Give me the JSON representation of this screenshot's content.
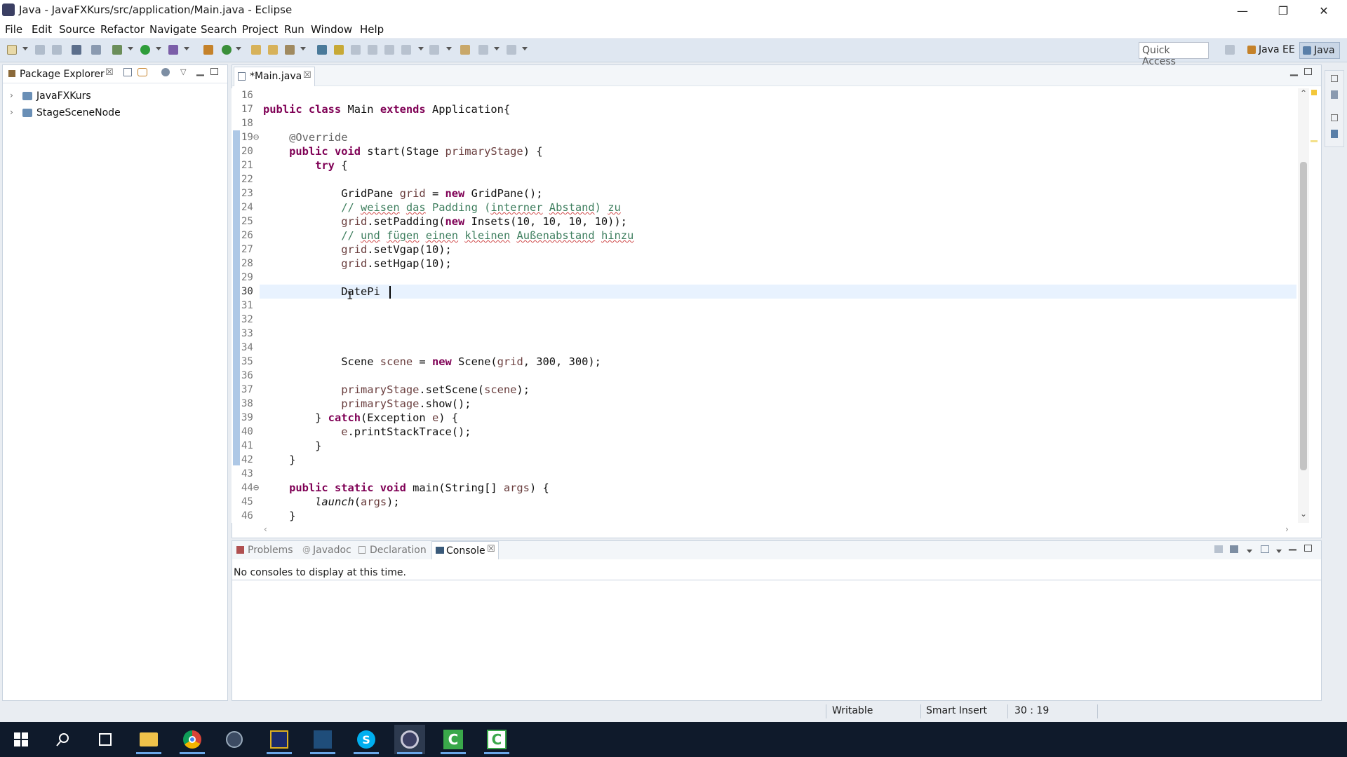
{
  "window": {
    "title": "Java - JavaFXKurs/src/application/Main.java - Eclipse",
    "min": "—",
    "max": "❐",
    "close": "✕"
  },
  "menu": [
    "File",
    "Edit",
    "Source",
    "Refactor",
    "Navigate",
    "Search",
    "Project",
    "Run",
    "Window",
    "Help"
  ],
  "toolbar": {
    "quick_access": "Quick Access",
    "perspectives": [
      "Java EE",
      "Java"
    ]
  },
  "package_explorer": {
    "tab": "Package Explorer",
    "items": [
      "JavaFXKurs",
      "StageSceneNode"
    ]
  },
  "editor": {
    "tab": "*Main.java",
    "lines": [
      {
        "n": "16",
        "tokens": []
      },
      {
        "n": "17",
        "tokens": [
          {
            "t": "public class ",
            "c": "kw"
          },
          {
            "t": "Main ",
            "c": ""
          },
          {
            "t": "extends ",
            "c": "kw"
          },
          {
            "t": "Application{",
            "c": ""
          }
        ]
      },
      {
        "n": "18",
        "tokens": []
      },
      {
        "n": "19⊖",
        "tokens": [
          {
            "t": "    @Override",
            "c": "an"
          }
        ]
      },
      {
        "n": "20",
        "tokens": [
          {
            "t": "    ",
            "c": ""
          },
          {
            "t": "public void ",
            "c": "kw"
          },
          {
            "t": "start(Stage ",
            "c": ""
          },
          {
            "t": "primaryStage",
            "c": "var"
          },
          {
            "t": ") {",
            "c": ""
          }
        ]
      },
      {
        "n": "21",
        "tokens": [
          {
            "t": "        ",
            "c": ""
          },
          {
            "t": "try ",
            "c": "kw"
          },
          {
            "t": "{",
            "c": ""
          }
        ]
      },
      {
        "n": "22",
        "tokens": []
      },
      {
        "n": "23",
        "tokens": [
          {
            "t": "            GridPane ",
            "c": ""
          },
          {
            "t": "grid",
            "c": "var"
          },
          {
            "t": " = ",
            "c": ""
          },
          {
            "t": "new ",
            "c": "kw"
          },
          {
            "t": "GridPane();",
            "c": ""
          }
        ]
      },
      {
        "n": "24",
        "tokens": [
          {
            "t": "            // ",
            "c": "cm"
          },
          {
            "t": "weisen",
            "c": "cm under"
          },
          {
            "t": " ",
            "c": "cm"
          },
          {
            "t": "das",
            "c": "cm under"
          },
          {
            "t": " Padding (",
            "c": "cm"
          },
          {
            "t": "interner",
            "c": "cm under"
          },
          {
            "t": " ",
            "c": "cm"
          },
          {
            "t": "Abstand",
            "c": "cm under"
          },
          {
            "t": ") ",
            "c": "cm"
          },
          {
            "t": "zu",
            "c": "cm under"
          }
        ]
      },
      {
        "n": "25",
        "tokens": [
          {
            "t": "            ",
            "c": ""
          },
          {
            "t": "grid",
            "c": "var"
          },
          {
            "t": ".setPadding(",
            "c": ""
          },
          {
            "t": "new ",
            "c": "kw"
          },
          {
            "t": "Insets(10, 10, 10, 10));",
            "c": ""
          }
        ]
      },
      {
        "n": "26",
        "tokens": [
          {
            "t": "            // ",
            "c": "cm"
          },
          {
            "t": "und",
            "c": "cm under"
          },
          {
            "t": " ",
            "c": "cm"
          },
          {
            "t": "fügen",
            "c": "cm under"
          },
          {
            "t": " ",
            "c": "cm"
          },
          {
            "t": "einen",
            "c": "cm under"
          },
          {
            "t": " ",
            "c": "cm"
          },
          {
            "t": "kleinen",
            "c": "cm under"
          },
          {
            "t": " ",
            "c": "cm"
          },
          {
            "t": "Außenabstand",
            "c": "cm under"
          },
          {
            "t": " ",
            "c": "cm"
          },
          {
            "t": "hinzu",
            "c": "cm under"
          }
        ]
      },
      {
        "n": "27",
        "tokens": [
          {
            "t": "            ",
            "c": ""
          },
          {
            "t": "grid",
            "c": "var"
          },
          {
            "t": ".setVgap(10);",
            "c": ""
          }
        ]
      },
      {
        "n": "28",
        "tokens": [
          {
            "t": "            ",
            "c": ""
          },
          {
            "t": "grid",
            "c": "var"
          },
          {
            "t": ".setHgap(10);",
            "c": ""
          }
        ]
      },
      {
        "n": "29",
        "tokens": []
      },
      {
        "n": "30",
        "tokens": [
          {
            "t": "            DatePi",
            "c": ""
          }
        ]
      },
      {
        "n": "31",
        "tokens": []
      },
      {
        "n": "32",
        "tokens": []
      },
      {
        "n": "33",
        "tokens": []
      },
      {
        "n": "34",
        "tokens": []
      },
      {
        "n": "35",
        "tokens": [
          {
            "t": "            Scene ",
            "c": ""
          },
          {
            "t": "scene",
            "c": "var"
          },
          {
            "t": " = ",
            "c": ""
          },
          {
            "t": "new ",
            "c": "kw"
          },
          {
            "t": "Scene(",
            "c": ""
          },
          {
            "t": "grid",
            "c": "var"
          },
          {
            "t": ", 300, 300);",
            "c": ""
          }
        ]
      },
      {
        "n": "36",
        "tokens": []
      },
      {
        "n": "37",
        "tokens": [
          {
            "t": "            ",
            "c": ""
          },
          {
            "t": "primaryStage",
            "c": "var"
          },
          {
            "t": ".setScene(",
            "c": ""
          },
          {
            "t": "scene",
            "c": "var"
          },
          {
            "t": ");",
            "c": ""
          }
        ]
      },
      {
        "n": "38",
        "tokens": [
          {
            "t": "            ",
            "c": ""
          },
          {
            "t": "primaryStage",
            "c": "var"
          },
          {
            "t": ".show();",
            "c": ""
          }
        ]
      },
      {
        "n": "39",
        "tokens": [
          {
            "t": "        } ",
            "c": ""
          },
          {
            "t": "catch",
            "c": "kw"
          },
          {
            "t": "(Exception ",
            "c": ""
          },
          {
            "t": "e",
            "c": "var"
          },
          {
            "t": ") {",
            "c": ""
          }
        ]
      },
      {
        "n": "40",
        "tokens": [
          {
            "t": "            ",
            "c": ""
          },
          {
            "t": "e",
            "c": "var"
          },
          {
            "t": ".printStackTrace();",
            "c": ""
          }
        ]
      },
      {
        "n": "41",
        "tokens": [
          {
            "t": "        }",
            "c": ""
          }
        ]
      },
      {
        "n": "42",
        "tokens": [
          {
            "t": "    }",
            "c": ""
          }
        ]
      },
      {
        "n": "43",
        "tokens": []
      },
      {
        "n": "44⊖",
        "tokens": [
          {
            "t": "    ",
            "c": ""
          },
          {
            "t": "public static void ",
            "c": "kw"
          },
          {
            "t": "main(String[] ",
            "c": ""
          },
          {
            "t": "args",
            "c": "var"
          },
          {
            "t": ") {",
            "c": ""
          }
        ]
      },
      {
        "n": "45",
        "tokens": [
          {
            "t": "        ",
            "c": ""
          },
          {
            "t": "launch",
            "c": "it"
          },
          {
            "t": "(",
            "c": ""
          },
          {
            "t": "args",
            "c": "var"
          },
          {
            "t": ");",
            "c": ""
          }
        ]
      },
      {
        "n": "46",
        "tokens": [
          {
            "t": "    }",
            "c": ""
          }
        ]
      }
    ]
  },
  "bottom_panel": {
    "tabs": [
      "Problems",
      "Javadoc",
      "Declaration",
      "Console"
    ],
    "message": "No consoles to display at this time."
  },
  "status": {
    "writable": "Writable",
    "insert": "Smart Insert",
    "position": "30 : 19"
  },
  "colors": {
    "keyword": "#7f0055",
    "comment": "#3f7f5f",
    "variable": "#6a3e3e",
    "current_line": "#e8f2fe"
  }
}
